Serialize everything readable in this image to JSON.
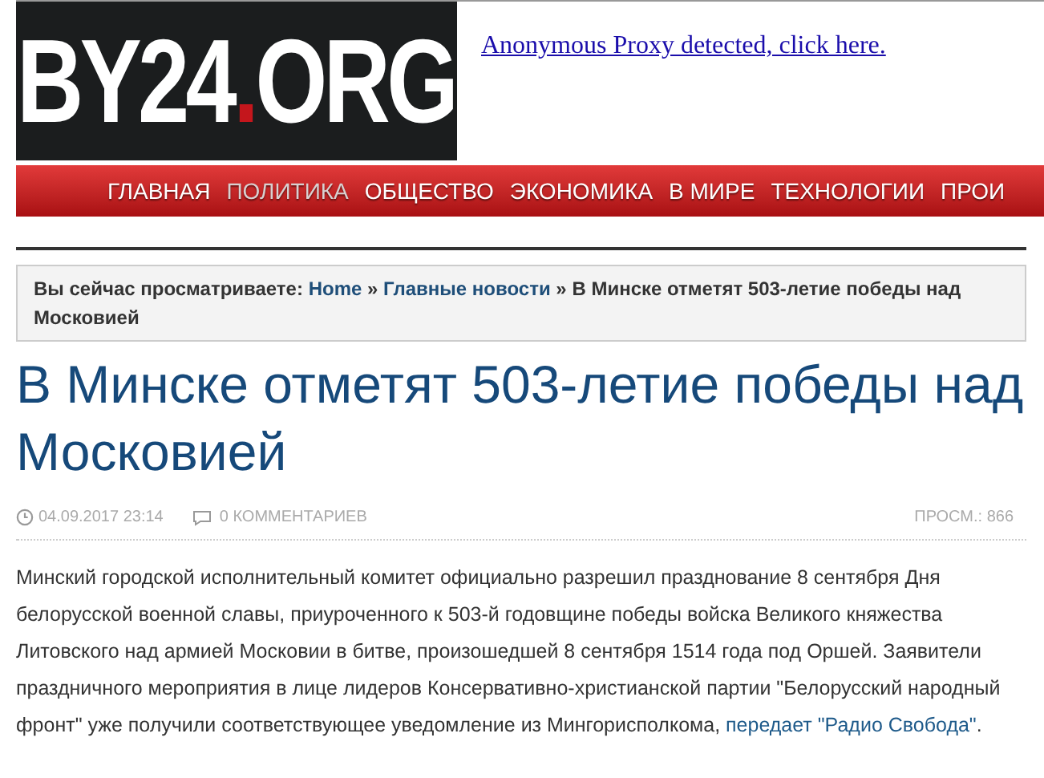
{
  "logo": {
    "before": "BY24",
    "dot": ".",
    "after": "ORG"
  },
  "proxy_notice": "Anonymous Proxy detected, click here.",
  "nav": [
    {
      "label": "ГЛАВНАЯ",
      "selected": false
    },
    {
      "label": "ПОЛИТИКА",
      "selected": true
    },
    {
      "label": "ОБЩЕСТВО",
      "selected": false
    },
    {
      "label": "ЭКОНОМИКА",
      "selected": false
    },
    {
      "label": "В МИРЕ",
      "selected": false
    },
    {
      "label": "ТЕХНОЛОГИИ",
      "selected": false
    },
    {
      "label": "ПРОИ",
      "selected": false
    }
  ],
  "breadcrumb": {
    "prefix": "Вы сейчас просматриваете:",
    "links": [
      "Home",
      "Главные новости"
    ],
    "separator": "»",
    "current": "В Минске отметят 503-летие победы над Московией"
  },
  "article": {
    "title": "В Минске отметят 503-летие победы над Московией",
    "date": "04.09.2017 23:14",
    "comments": "0 КОММЕНТАРИЕВ",
    "views": "ПРОСМ.: 866",
    "body": "Минский городской исполнительный комитет официально разрешил празднование 8 сентября Дня белорусской военной славы, приуроченного к 503-й годовщине победы войска Великого княжества Литовского над армией Московии в битве, произошедшей 8 сентября 1514 года под Оршей. Заявители праздничного мероприятия в лице лидеров Консервативно-христианской партии \"Белорусский народный фронт\" уже получили соответствующее уведомление из Мингорисполкома,",
    "source_link": "передает \"Радио Свобода\"",
    "end": "."
  }
}
